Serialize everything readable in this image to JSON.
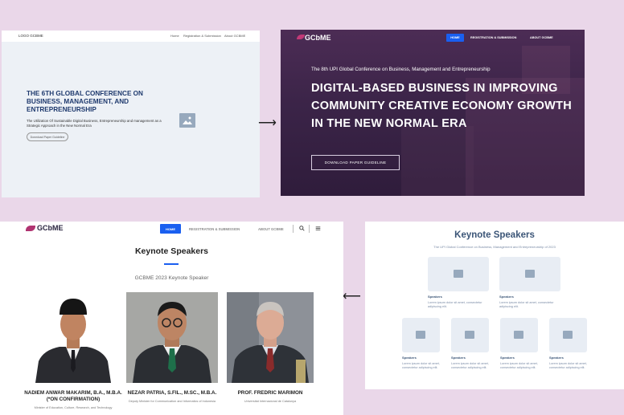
{
  "wireframe_hero": {
    "logo": "LOGO GCBME",
    "nav": [
      "Home",
      "Registration & Submission",
      "About GCBME"
    ],
    "title": "THE 6TH GLOBAL CONFERENCE ON BUSINESS, MANAGEMENT, AND ENTREPRENEURSHIP",
    "subtitle": "The Utilization Of Sustainable Digital Business, Entrepreneurship and management as a Strategic Approach in the New Normal Era",
    "button": "Download Paper Guideline"
  },
  "hero": {
    "logo": "GCbME",
    "nav_home": "HOME",
    "nav": [
      "REGISTRATION & SUBMISSION",
      "ABOUT GCBME"
    ],
    "kicker": "The 8th UPI Global Conference on Business, Management and Entrepreneurship",
    "title": "DIGITAL-BASED BUSINESS IN IMPROVING COMMUNITY CREATIVE ECONOMY GROWTH IN THE NEW NORMAL ERA",
    "button": "DOWNLOAD PAPER GUIDELINE"
  },
  "arrows": {
    "right": "⟶",
    "left": "⟵"
  },
  "wireframe_speakers": {
    "title": "Keynote Speakers",
    "subtitle": "The UPI Global Conference on Business, Management and Entrepreneurship of 2023",
    "label": "Speakers",
    "desc": "Lorem ipsum dolor sit amet, consectetur adipiscing elit."
  },
  "speakers_page": {
    "logo": "GCbME",
    "nav_home": "HOME",
    "nav": [
      "REGISTRATION & SUBMISSION",
      "ABOUT GCBME"
    ],
    "title": "Keynote Speakers",
    "subtitle": "GCBME 2023 Keynote Speaker",
    "speakers": [
      {
        "name": "NADIEM ANWAR MAKARIM, B.A., M.B.A. (*ON CONFIRMATION)",
        "role": "Minister of Education, Culture, Research, and Technology"
      },
      {
        "name": "NEZAR PATRIA, S.FIL., M.SC., M.B.A.",
        "role": "Deputy Minister for Communication and Informatics of Indonesia"
      },
      {
        "name": "PROF. FREDRIC MARIMON",
        "role": "Universitat Internacional de Catalunya"
      }
    ]
  }
}
